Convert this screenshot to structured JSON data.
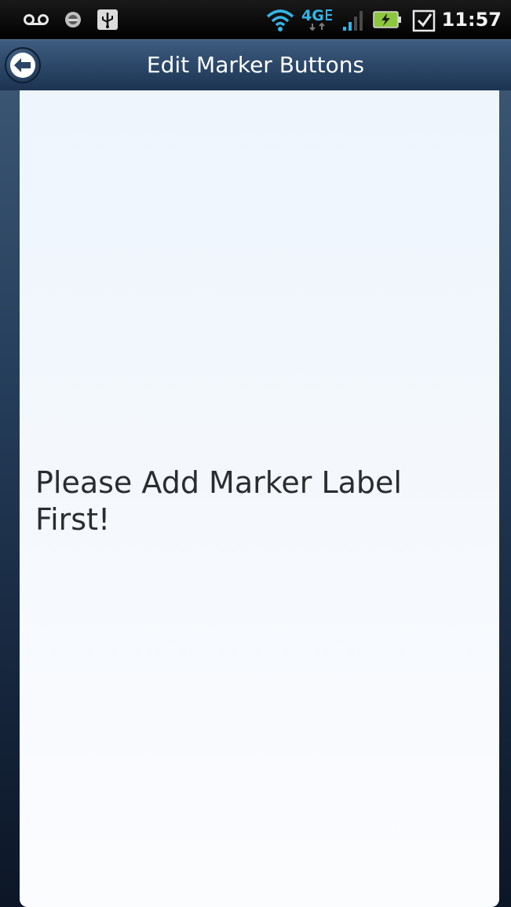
{
  "status_bar": {
    "time": "11:57",
    "icons": [
      "voicemail-icon",
      "notification-icon",
      "usb-icon",
      "wifi-icon",
      "4g-lte-icon",
      "signal-icon",
      "battery-charging-icon",
      "task-done-icon"
    ],
    "network_label": "4G"
  },
  "header": {
    "title": "Edit Marker Buttons",
    "back_icon": "back-arrow-icon"
  },
  "main": {
    "empty_message": "Please Add Marker Label First!"
  },
  "colors": {
    "header": "#2a4566",
    "panel": "#f4f8fd",
    "text": "#2a2d30",
    "battery": "#8cc63f",
    "network": "#33b5e5"
  }
}
